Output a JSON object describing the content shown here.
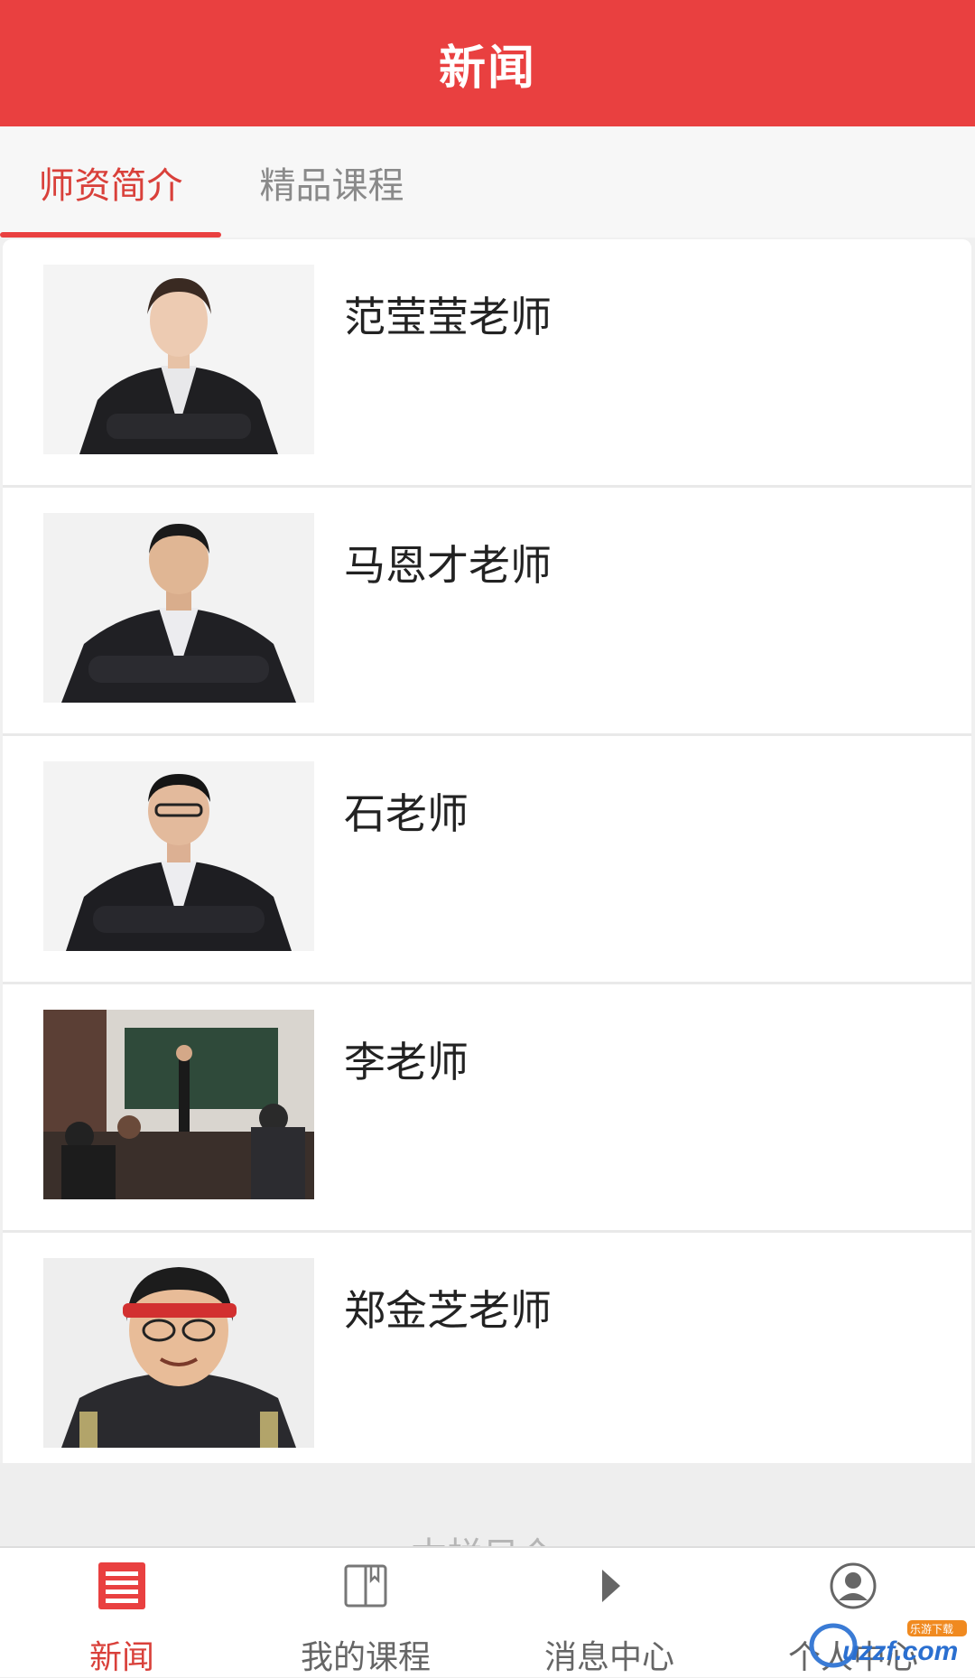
{
  "header": {
    "title": "新闻"
  },
  "tabs": [
    {
      "label": "师资简介",
      "active": true
    },
    {
      "label": "精品课程",
      "active": false
    }
  ],
  "teachers": [
    {
      "name": "范莹莹老师"
    },
    {
      "name": "马恩才老师"
    },
    {
      "name": "石老师"
    },
    {
      "name": "李老师"
    },
    {
      "name": "郑金芝老师"
    }
  ],
  "partial_text": "本栏目介",
  "bottom_nav": [
    {
      "label": "新闻",
      "icon": "news-list-icon",
      "active": true
    },
    {
      "label": "我的课程",
      "icon": "book-icon",
      "active": false
    },
    {
      "label": "消息中心",
      "icon": "play-triangle-icon",
      "active": false
    },
    {
      "label": "个人中心",
      "icon": "user-avatar-icon",
      "active": false
    }
  ],
  "watermark": {
    "text": "uzzf.com",
    "badge": "乐游下载"
  },
  "colors": {
    "accent": "#e94040",
    "active_text": "#d9403a",
    "inactive_text": "#8a8a8a"
  }
}
